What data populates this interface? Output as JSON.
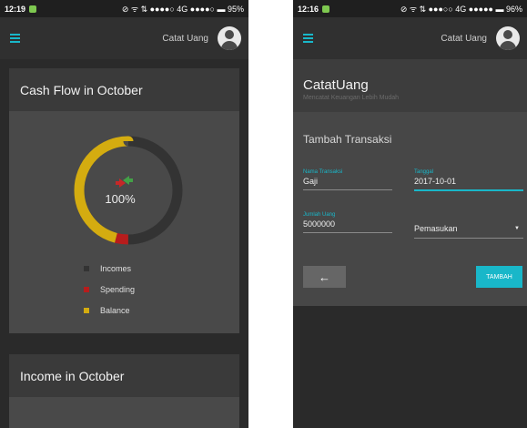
{
  "screen1": {
    "status": {
      "time": "12:19",
      "right": "⊘ ᯤ ⇅ ●●●●○ 4G ●●●●○ ▬ 95%"
    },
    "appbar_title": "Catat Uang",
    "card1": {
      "title": "Cash Flow in October",
      "donut_label": "100%",
      "legend": [
        {
          "label": "Incomes",
          "color": "#333333"
        },
        {
          "label": "Spending",
          "color": "#b71c1c"
        },
        {
          "label": "Balance",
          "color": "#d4ac10"
        }
      ]
    },
    "card2": {
      "title": "Income in October"
    }
  },
  "screen2": {
    "status": {
      "time": "12:16",
      "right": "⊘ ᯤ ⇅ ●●●○○ 4G ●●●●● ▬ 96%"
    },
    "appbar_title": "Catat Uang",
    "brand": "CatatUang",
    "tagline": "Mencatat Keuangan Lebih Mudah",
    "form": {
      "title": "Tambah Transaksi",
      "name_label": "Nama Transaksi",
      "name_value": "Gaji",
      "date_label": "Tanggal",
      "date_value": "2017-10-01",
      "amount_label": "Jumlah Uang",
      "amount_value": "5000000",
      "type_value": "Pemasukan",
      "back_icon": "←",
      "submit_label": "TAMBAH"
    }
  },
  "chart_data": {
    "type": "pie",
    "title": "Cash Flow in October",
    "categories": [
      "Incomes",
      "Spending",
      "Balance"
    ],
    "values": [
      50,
      4,
      46
    ],
    "colors": [
      "#333333",
      "#b71c1c",
      "#d4ac10"
    ],
    "center_label": "100%"
  }
}
